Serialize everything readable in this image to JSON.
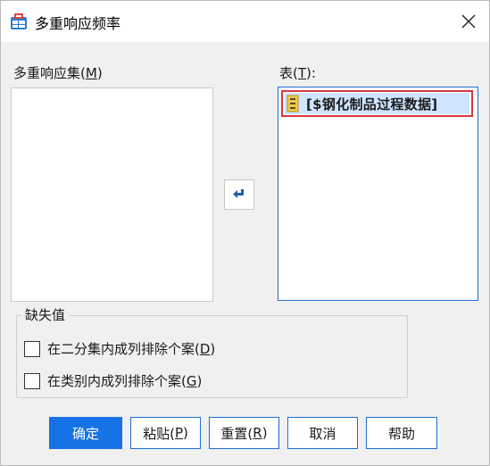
{
  "window": {
    "title": "多重响应频率"
  },
  "left_list": {
    "label_prefix": "多重响应集(",
    "label_key": "M",
    "label_suffix": ")",
    "items": []
  },
  "right_list": {
    "label_prefix": "表(",
    "label_key": "T",
    "label_suffix": "):",
    "items": [
      {
        "text": "[$钢化制品过程数据]"
      }
    ]
  },
  "missing_values": {
    "legend": "缺失值",
    "options": [
      {
        "prefix": "在二分集内成列排除个案(",
        "key": "D",
        "suffix": ")",
        "checked": false
      },
      {
        "prefix": "在类别内成列排除个案(",
        "key": "G",
        "suffix": ")",
        "checked": false
      }
    ]
  },
  "buttons": {
    "ok": {
      "label": "确定"
    },
    "paste": {
      "prefix": "粘贴(",
      "key": "P",
      "suffix": ")"
    },
    "reset": {
      "prefix": "重置(",
      "key": "R",
      "suffix": ")"
    },
    "cancel": {
      "label": "取消"
    },
    "help": {
      "label": "帮助"
    }
  },
  "colors": {
    "accent": "#1573e6",
    "selection_border": "#d9363e",
    "selection_fill": "#cfe4ff",
    "arrow": "#1e5fb4"
  },
  "icons": {
    "app": "spss-table-icon",
    "close": "close-icon",
    "move": "arrow-left-icon",
    "variable": "multiple-response-set-icon"
  }
}
